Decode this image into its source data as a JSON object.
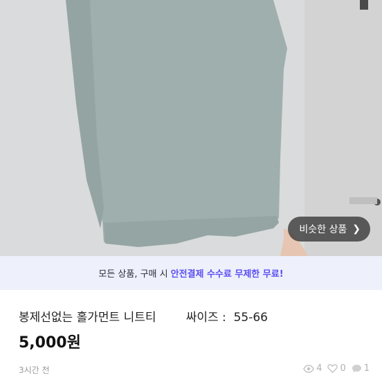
{
  "similar_button": {
    "label": "비슷한 상품",
    "arrow": "chevron-right-icon"
  },
  "banner": {
    "text_prefix": "모든 상품, 구매 시",
    "text_accent": "안전결제 수수료 무제한 무료!",
    "accent_color": "#5b4ff2"
  },
  "product": {
    "title": "봉제선없는 홀가먼트 니트티        싸이즈 :  55-66",
    "price": "5,000원",
    "posted": "3시간 전"
  },
  "stats": {
    "views": "4",
    "likes": "0",
    "chats": "1"
  }
}
